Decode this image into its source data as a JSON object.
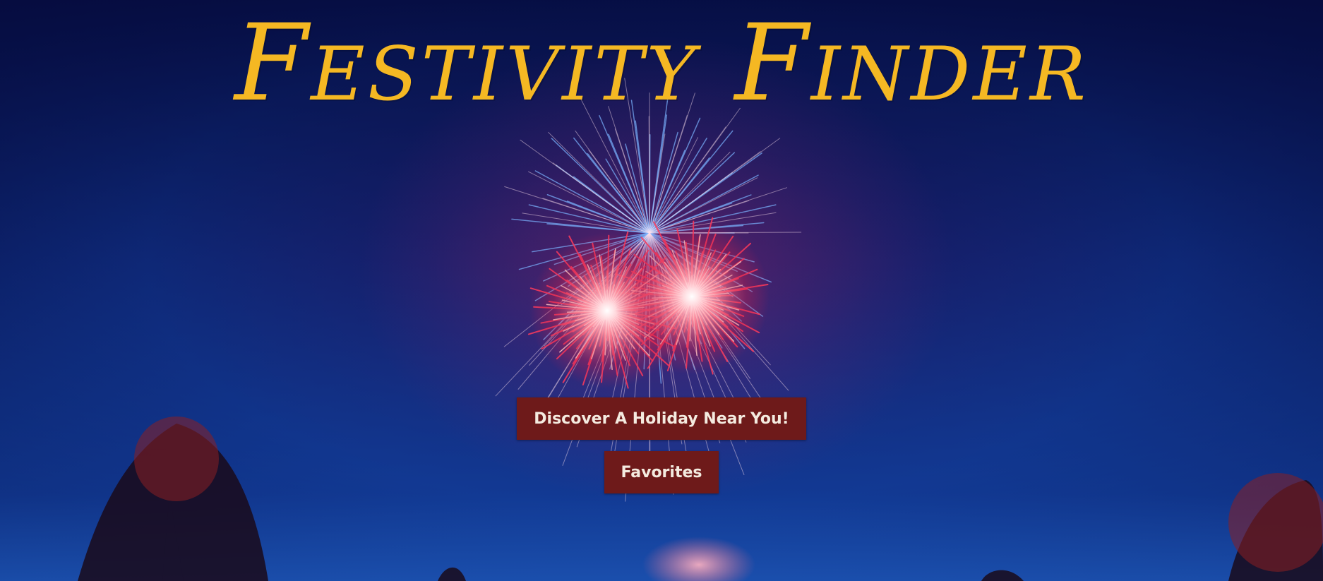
{
  "hero": {
    "title": "Festivity Finder"
  },
  "actions": {
    "discover_label": "Discover A Holiday Near You!",
    "favorites_label": "Favorites"
  },
  "colors": {
    "title": "#f5b823",
    "button_bg": "#6e1a1a",
    "button_text": "#f4ebe0",
    "sky": "#0f2a78"
  }
}
